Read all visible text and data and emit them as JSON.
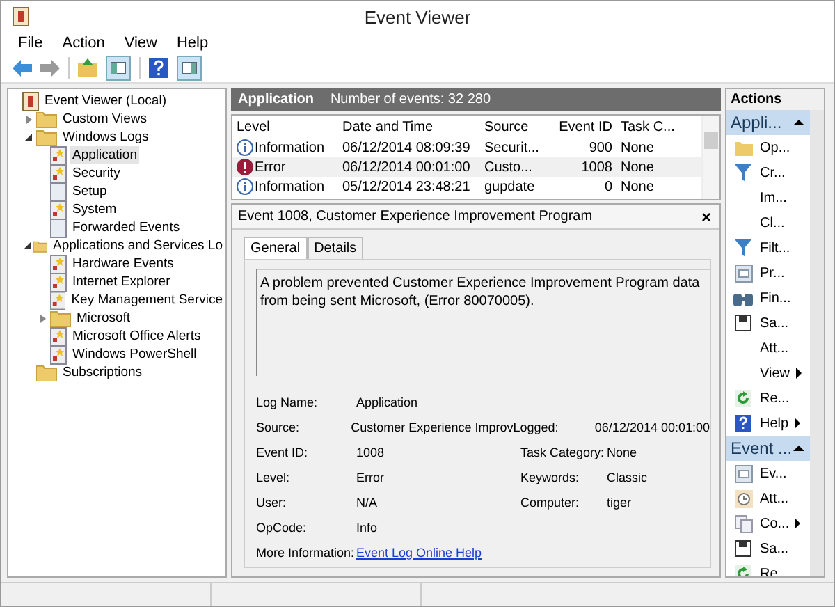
{
  "window": {
    "title": "Event Viewer"
  },
  "menu": [
    "File",
    "Action",
    "View",
    "Help"
  ],
  "tree": [
    {
      "label": "Event Viewer (Local)",
      "kind": "root",
      "selected": false,
      "children": [
        {
          "label": "Custom Views",
          "kind": "folder",
          "selected": false,
          "expanded": false
        },
        {
          "label": "Windows Logs",
          "kind": "folder",
          "selected": false,
          "expanded": true,
          "children": [
            {
              "label": "Application",
              "kind": "log",
              "selected": true
            },
            {
              "label": "Security",
              "kind": "log",
              "selected": false
            },
            {
              "label": "Setup",
              "kind": "plain",
              "selected": false
            },
            {
              "label": "System",
              "kind": "log",
              "selected": false
            },
            {
              "label": "Forwarded Events",
              "kind": "plain",
              "selected": false
            }
          ]
        },
        {
          "label": "Applications and Services Lo",
          "kind": "folder",
          "selected": false,
          "expanded": true,
          "children": [
            {
              "label": "Hardware Events",
              "kind": "log",
              "selected": false
            },
            {
              "label": "Internet Explorer",
              "kind": "log",
              "selected": false
            },
            {
              "label": "Key Management Service",
              "kind": "log",
              "selected": false
            },
            {
              "label": "Microsoft",
              "kind": "folder",
              "selected": false,
              "expanded": false
            },
            {
              "label": "Microsoft Office Alerts",
              "kind": "log",
              "selected": false
            },
            {
              "label": "Windows PowerShell",
              "kind": "log",
              "selected": false
            }
          ]
        },
        {
          "label": "Subscriptions",
          "kind": "folder",
          "selected": false
        }
      ]
    }
  ],
  "log_header": {
    "name": "Application",
    "count": "Number of events: 32 280"
  },
  "events": {
    "columns": [
      "Level",
      "Date and Time",
      "Source",
      "Event ID",
      "Task C..."
    ],
    "rows": [
      {
        "kind": "info",
        "level": "Information",
        "time": "06/12/2014 08:09:39",
        "source": "Securit...",
        "id": "900",
        "task": "None",
        "selected": false
      },
      {
        "kind": "error",
        "level": "Error",
        "time": "06/12/2014 00:01:00",
        "source": "Custo...",
        "id": "1008",
        "task": "None",
        "selected": true
      },
      {
        "kind": "info",
        "level": "Information",
        "time": "05/12/2014 23:48:21",
        "source": "gupdate",
        "id": "0",
        "task": "None",
        "selected": false
      }
    ]
  },
  "detail": {
    "title": "Event 1008, Customer Experience Improvement Program",
    "close": "×",
    "tabs": [
      {
        "label": "General",
        "selected": true
      },
      {
        "label": "Details",
        "selected": false
      }
    ],
    "description": "A problem prevented Customer Experience Improvement Program data from being sent Microsoft, (Error 80070005).",
    "fields": [
      {
        "left": {
          "label": "Log Name:",
          "value": "Application"
        }
      },
      {
        "left": {
          "label": "Source:",
          "value": "Customer Experience Improv"
        },
        "right": {
          "label": "Logged:",
          "value": "06/12/2014 00:01:00"
        }
      },
      {
        "left": {
          "label": "Event ID:",
          "value": "1008"
        },
        "right": {
          "label": "Task Category:",
          "value": "None"
        }
      },
      {
        "left": {
          "label": "Level:",
          "value": "Error"
        },
        "right": {
          "label": "Keywords:",
          "value": "Classic"
        }
      },
      {
        "left": {
          "label": "User:",
          "value": "N/A"
        },
        "right": {
          "label": "Computer:",
          "value": "tiger"
        }
      },
      {
        "left": {
          "label": "OpCode:",
          "value": "Info"
        }
      },
      {
        "left": {
          "label": "More Information:",
          "value": "Event Log Online Help",
          "kind": "link"
        }
      }
    ]
  },
  "actions": {
    "title": "Actions",
    "groups": [
      {
        "title": "Appli...",
        "expanded": true,
        "items": [
          {
            "label": "Op...",
            "kind": "folder",
            "submenu": false
          },
          {
            "label": "Cr...",
            "kind": "filter",
            "submenu": false
          },
          {
            "label": "Im...",
            "kind": "none",
            "submenu": false
          },
          {
            "label": "Cl...",
            "kind": "none",
            "submenu": false
          },
          {
            "label": "Filt...",
            "kind": "filter",
            "submenu": false
          },
          {
            "label": "Pr...",
            "kind": "properties",
            "submenu": false
          },
          {
            "label": "Fin...",
            "kind": "find",
            "submenu": false
          },
          {
            "label": "Sa...",
            "kind": "save",
            "submenu": false
          },
          {
            "label": "Att...",
            "kind": "none",
            "submenu": false
          },
          {
            "label": "View",
            "kind": "none",
            "submenu": true
          },
          {
            "label": "Re...",
            "kind": "refresh",
            "submenu": false
          },
          {
            "label": "Help",
            "kind": "help",
            "submenu": true
          }
        ]
      },
      {
        "title": "Event ...",
        "expanded": true,
        "items": [
          {
            "label": "Ev...",
            "kind": "properties",
            "submenu": false
          },
          {
            "label": "Att...",
            "kind": "clock",
            "submenu": false
          },
          {
            "label": "Co...",
            "kind": "copy",
            "submenu": true
          },
          {
            "label": "Sa...",
            "kind": "save",
            "submenu": false
          },
          {
            "label": "Re...",
            "kind": "refresh",
            "submenu": false
          }
        ]
      }
    ]
  }
}
